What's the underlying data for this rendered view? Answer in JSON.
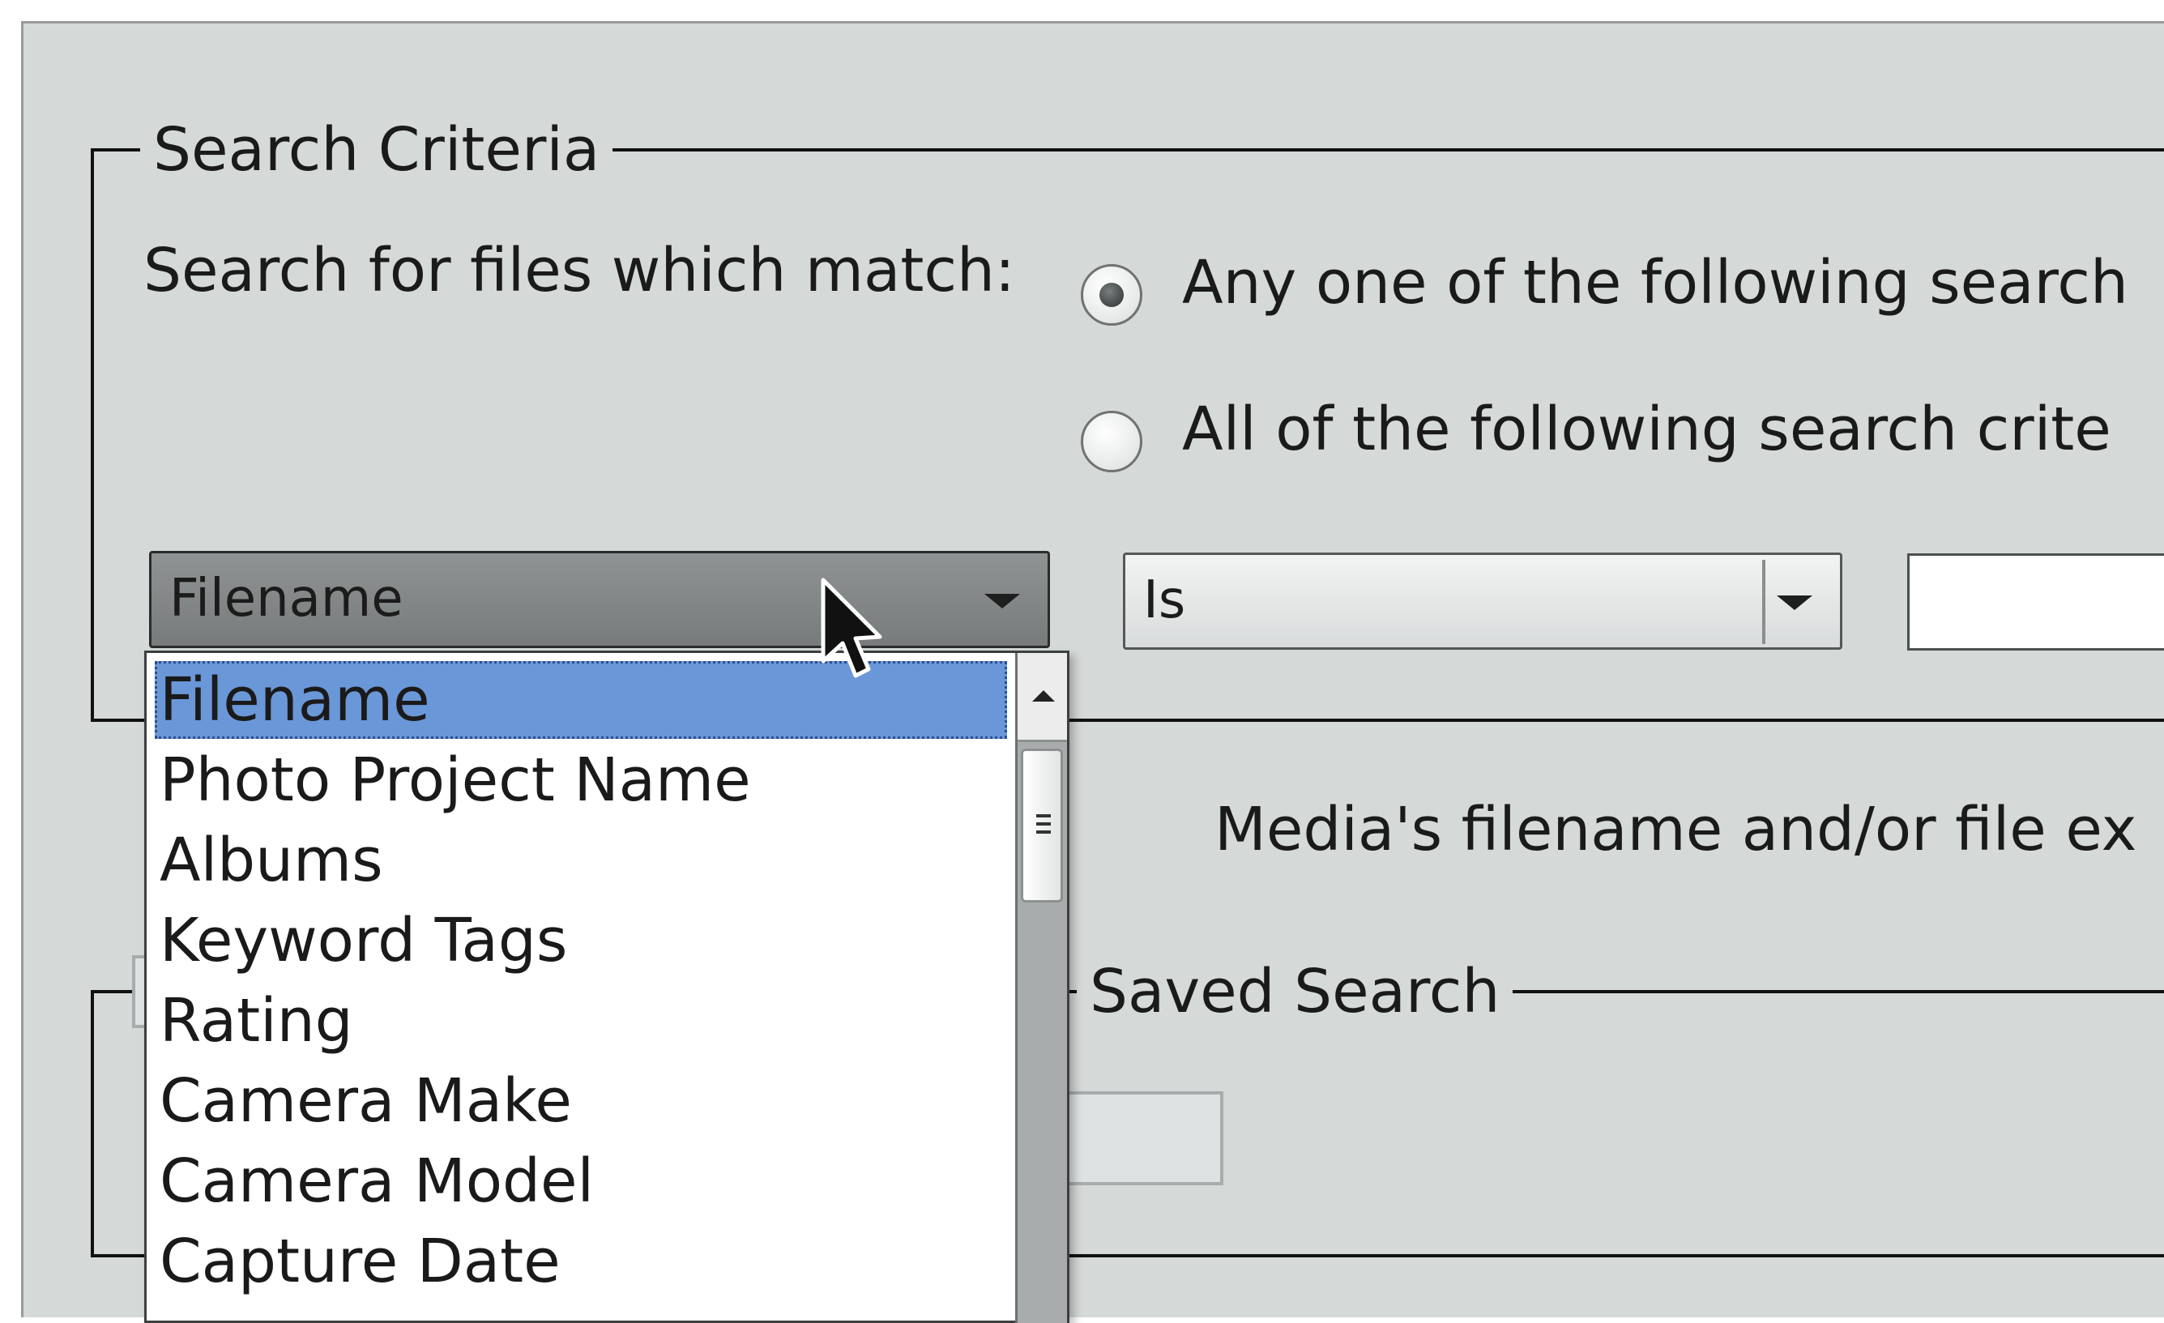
{
  "search_criteria": {
    "legend": "Search Criteria",
    "match_label": "Search for files which match:",
    "radio_any": {
      "label": "Any one of the following search",
      "checked": true
    },
    "radio_all": {
      "label": "All of the following search crite",
      "checked": false
    },
    "field_select": {
      "value": "Filename"
    },
    "operator_select": {
      "value": "Is"
    },
    "value_input": {
      "value": ""
    }
  },
  "description_text": "Media's filename and/or file ex",
  "saved_search": {
    "legend": "Saved Search"
  },
  "field_dropdown": {
    "items": [
      {
        "label": "Filename",
        "selected": true
      },
      {
        "label": "Photo Project Name",
        "selected": false
      },
      {
        "label": "Albums",
        "selected": false
      },
      {
        "label": "Keyword Tags",
        "selected": false
      },
      {
        "label": "Rating",
        "selected": false
      },
      {
        "label": "Camera Make",
        "selected": false
      },
      {
        "label": "Camera Model",
        "selected": false
      },
      {
        "label": "Capture Date",
        "selected": false
      }
    ]
  },
  "icons": {
    "dropdown_arrow": "chevron-down-icon",
    "scroll_up": "scroll-up-arrow-icon",
    "cursor": "mouse-pointer-icon"
  },
  "colors": {
    "dialog_bg": "#d5d9d8",
    "selection": "#6a97d8"
  }
}
